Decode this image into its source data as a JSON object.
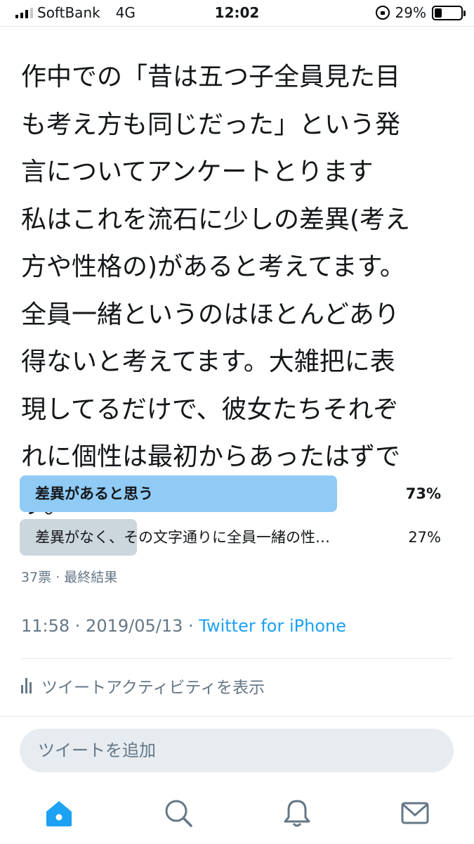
{
  "status_bar": {
    "carrier": "SoftBank",
    "network": "4G",
    "time": "12:02",
    "battery": "29%",
    "battery_level": 0.29
  },
  "top_cut_text": "…",
  "tweet": {
    "text": "作中での「昔は五つ子全員見た目\nも考え方も同じだった」という発\n言についてアンケートとります\n私はこれを流石に少しの差異(考え\n方や性格の)があると考えてます。\n全員一緒というのはほとんどあり\n得ないと考えてます。大雑把に表\n現してるだけで、彼女たちそれぞ\nれに個性は最初からあったはずで\nす。"
  },
  "poll": {
    "options": [
      {
        "label": "差異があると思う",
        "percent": "73%",
        "fraction": 0.73,
        "winner": true
      },
      {
        "label": "差異がなく、その文字通りに全員一緒の性…",
        "percent": "27%",
        "fraction": 0.27,
        "winner": false
      }
    ],
    "meta": "37票 · 最終結果"
  },
  "timestamp": {
    "time_date": "11:58 · 2019/05/13 · ",
    "source": "Twitter for iPhone"
  },
  "activity": {
    "label": "ツイートアクティビティを表示",
    "icon": "stats-icon"
  },
  "compose": {
    "placeholder": "ツイートを追加"
  },
  "tab_bar": {
    "items": [
      "home-icon",
      "search-icon",
      "notifications-icon",
      "messages-icon"
    ],
    "active_color": "#1da1f2",
    "inactive_color": "#657786"
  }
}
